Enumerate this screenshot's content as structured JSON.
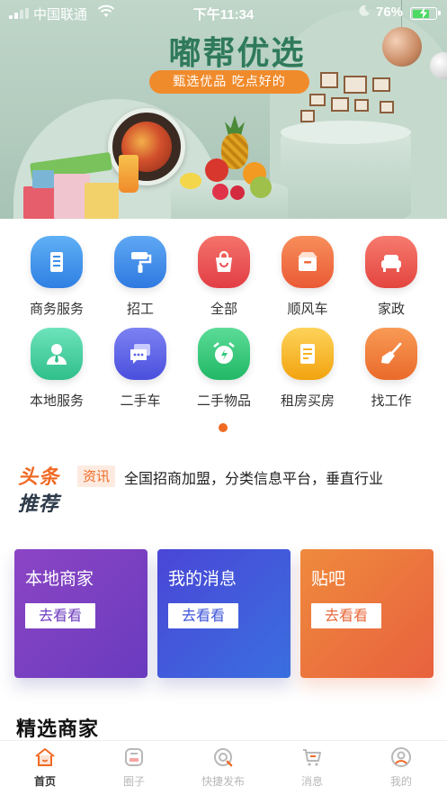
{
  "status_bar": {
    "carrier": "中国联通",
    "time": "下午11:34",
    "battery_percent": "76%",
    "battery_level": 0.76
  },
  "banner": {
    "title": "嘟帮优选",
    "subtitle": "甄选优品 吃点好的"
  },
  "categories": [
    {
      "label": "商务服务",
      "icon": "building-icon",
      "color": "#3d8fe8"
    },
    {
      "label": "招工",
      "icon": "paint-roller-icon",
      "color": "#3f8ae6"
    },
    {
      "label": "全部",
      "icon": "shopping-bag-icon",
      "color": "#ec4f4f"
    },
    {
      "label": "顺风车",
      "icon": "box-icon",
      "color": "#f0683a"
    },
    {
      "label": "家政",
      "icon": "sofa-icon",
      "color": "#ef5a4f"
    },
    {
      "label": "本地服务",
      "icon": "person-icon",
      "color": "#3ccf9e"
    },
    {
      "label": "二手车",
      "icon": "chat-bubble-icon",
      "color": "#5b61e6"
    },
    {
      "label": "二手物品",
      "icon": "alarm-clock-icon",
      "color": "#34c77a"
    },
    {
      "label": "租房买房",
      "icon": "document-icon",
      "color": "#f5b31d"
    },
    {
      "label": "找工作",
      "icon": "broom-icon",
      "color": "#f07c33"
    }
  ],
  "headlines": {
    "logo_line1": "头条",
    "logo_line2": "推荐",
    "tag": "资讯",
    "text": "全国招商加盟，分类信息平台，垂直行业"
  },
  "cards": [
    {
      "title": "本地商家",
      "button": "去看看"
    },
    {
      "title": "我的消息",
      "button": "去看看"
    },
    {
      "title": "贴吧",
      "button": "去看看"
    }
  ],
  "section_title": "精选商家",
  "tabs": [
    {
      "label": "首页",
      "icon": "home-icon",
      "active": true
    },
    {
      "label": "圈子",
      "icon": "circle-face-icon",
      "active": false
    },
    {
      "label": "快捷发布",
      "icon": "quick-publish-icon",
      "active": false
    },
    {
      "label": "消息",
      "icon": "cart-icon",
      "active": false
    },
    {
      "label": "我的",
      "icon": "user-icon",
      "active": false
    }
  ],
  "colors": {
    "accent": "#f06a24",
    "headline_dark": "#2c3a4a"
  }
}
